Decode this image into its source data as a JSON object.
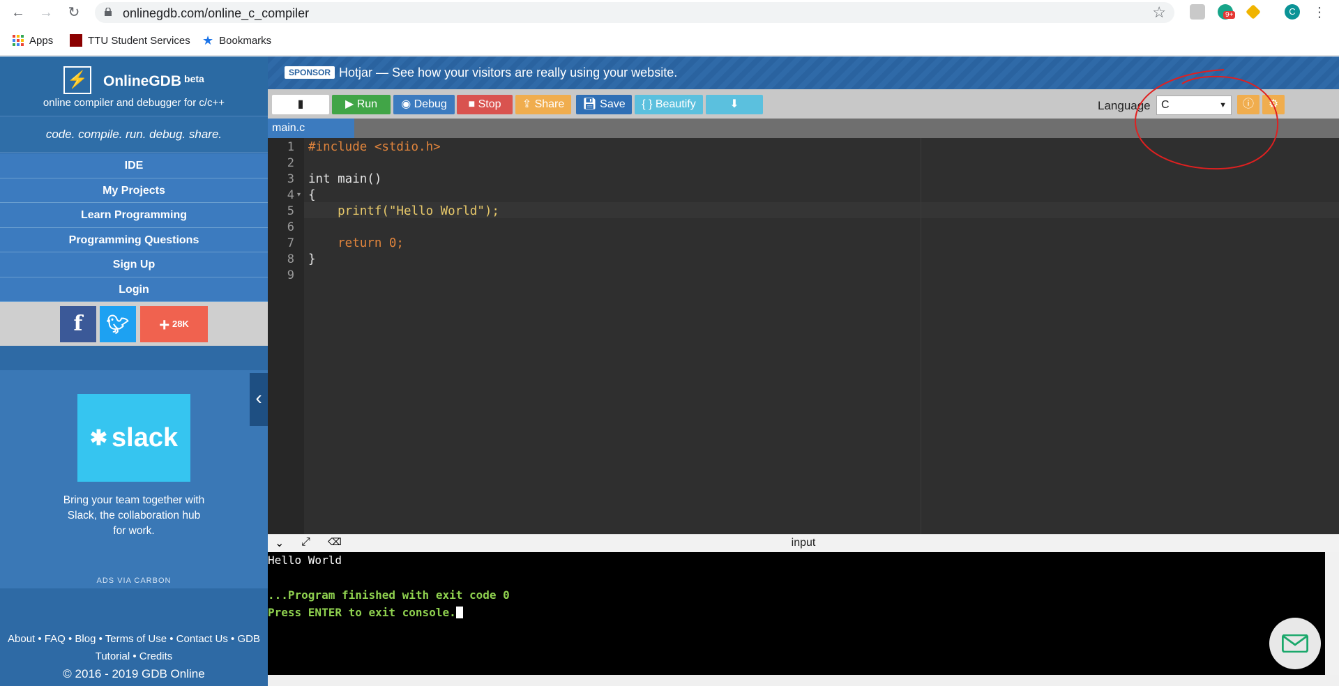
{
  "browser": {
    "url": "onlinegdb.com/online_c_compiler",
    "ext_badge": "9+",
    "profile_initial": "C",
    "bookmarks": [
      {
        "label": "Apps"
      },
      {
        "label": "TTU Student Services"
      },
      {
        "label": "Bookmarks"
      }
    ]
  },
  "sidebar": {
    "brand": "OnlineGDB",
    "beta": "beta",
    "subtitle": "online compiler and debugger for c/c++",
    "tagline": "code. compile. run. debug. share.",
    "menu": [
      "IDE",
      "My Projects",
      "Learn Programming",
      "Programming Questions",
      "Sign Up",
      "Login"
    ],
    "share_count": "28K",
    "ad": {
      "brand": "slack",
      "text": "Bring your team together with Slack, the collaboration hub for work.",
      "via": "ADS VIA CARBON"
    },
    "footer": {
      "line1": "About • FAQ • Blog • Terms of Use • Contact Us • GDB",
      "line2": "Tutorial • Credits",
      "copyright": "© 2016 - 2019 GDB Online"
    }
  },
  "sponsor": {
    "badge": "SPONSOR",
    "text": "Hotjar — See how your visitors are really using your website."
  },
  "toolbar": {
    "run": "Run",
    "debug": "Debug",
    "stop": "Stop",
    "share": "Share",
    "save": "Save",
    "beautify": "{ } Beautify",
    "language_label": "Language",
    "language_value": "C"
  },
  "editor": {
    "tab": "main.c",
    "line_numbers": [
      "1",
      "2",
      "3",
      "4",
      "5",
      "6",
      "7",
      "8",
      "9"
    ],
    "lines": [
      "#include <stdio.h>",
      "",
      "int main()",
      "{",
      "    printf(\"Hello World\");",
      "",
      "    return 0;",
      "}",
      ""
    ]
  },
  "console": {
    "title": "input",
    "out1": "Hello World",
    "out2": "...Program finished with exit code 0",
    "out3": "Press ENTER to exit console."
  },
  "colors": {
    "sidebar": "#2e6aa5",
    "run": "#41a547",
    "debug": "#3c7bbf",
    "stop": "#d9534f",
    "share": "#f0ad4e",
    "save": "#2f6fb5",
    "beautify": "#5bc0de",
    "download": "#5bc0de",
    "console_green": "#8fd14f",
    "annotation": "#e02020"
  }
}
